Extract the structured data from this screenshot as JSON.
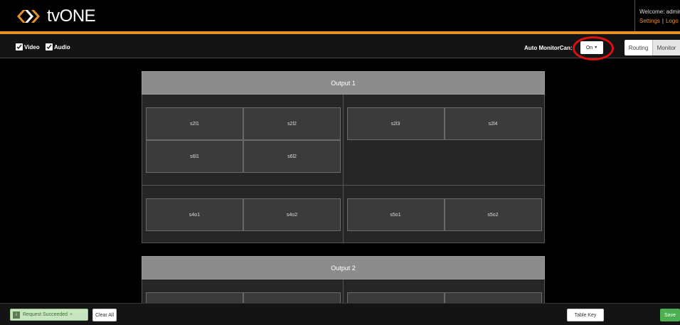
{
  "header": {
    "brand": "tvONE",
    "welcome": "Welcome: admin",
    "settings_link": "Settings",
    "separator": "|",
    "logout_link": "Logo",
    "accent_color": "#e8912b"
  },
  "toolbar": {
    "video_label": "Video",
    "video_checked": true,
    "audio_label": "Audio",
    "audio_checked": true,
    "auto_monitor_label": "Auto MonitorCan:",
    "auto_monitor_value": "On",
    "view_tabs": [
      "Routing",
      "Monitor"
    ],
    "active_view": "Monitor"
  },
  "outputs": [
    {
      "title": "Output 1",
      "groups": [
        {
          "tiles": [
            "s2l1",
            "s2l2",
            "s6l1",
            "s6l2"
          ]
        },
        {
          "tiles": [
            "s2l3",
            "s2l4"
          ]
        },
        {
          "tiles": [
            "s4o1",
            "s4o2"
          ]
        },
        {
          "tiles": [
            "s5o1",
            "s5o2"
          ]
        }
      ]
    },
    {
      "title": "Output 2",
      "groups": [
        {
          "tiles": []
        },
        {
          "tiles": []
        }
      ]
    }
  ],
  "footer": {
    "toast_text": "Request Succeeded",
    "toast_close": "×",
    "clear_all_label": "Clear All",
    "table_key_label": "Table Key",
    "save_label": "Save",
    "save_color": "#4caf50"
  },
  "icons": {
    "logo": "tvone-chevron-logo",
    "checkbox": "checkmark-icon",
    "toast": "info-icon",
    "dropdown": "caret-down-icon"
  }
}
